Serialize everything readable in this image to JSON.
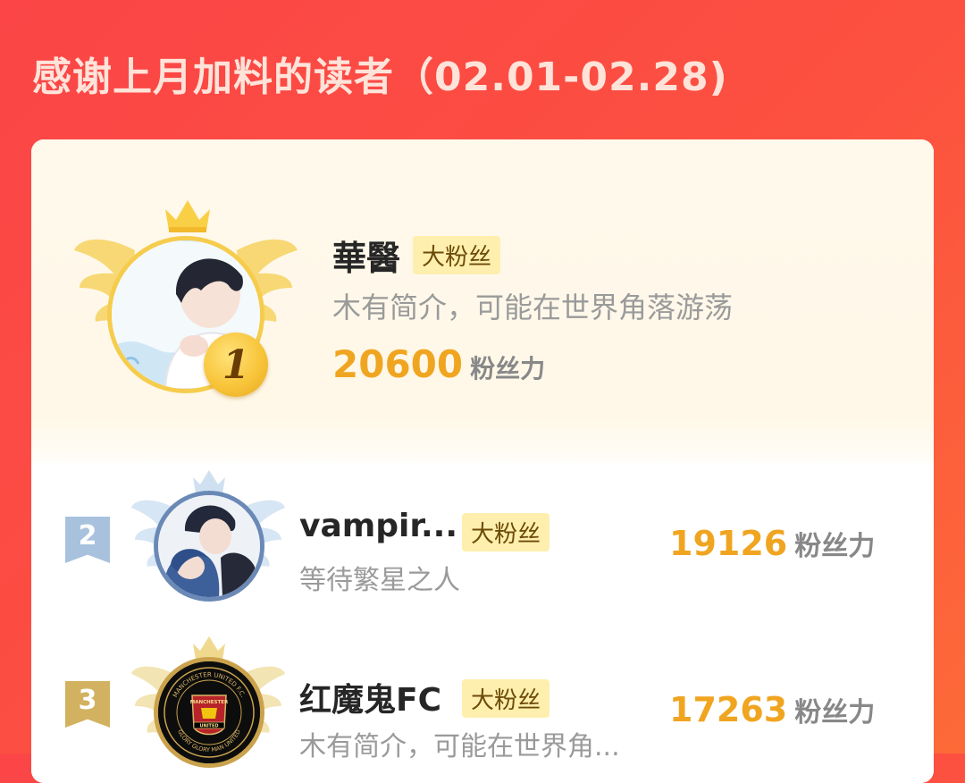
{
  "header": {
    "title": "感谢上月加料的读者（02.01-02.28)"
  },
  "colors": {
    "gold": "#f0a521",
    "badge_bg": "#ffefae",
    "red_bg": "#fb4547"
  },
  "top_fan": {
    "rank": "1",
    "name": "華醫",
    "badge": "大粉丝",
    "bio": "木有简介，可能在世界角落游荡",
    "score": "20600",
    "score_unit": "粉丝力",
    "frame_icon": "gold-crown-wings-frame"
  },
  "fans": [
    {
      "rank": "2",
      "name": "vampir...",
      "badge": "大粉丝",
      "bio": "等待繁星之人",
      "score": "19126",
      "score_unit": "粉丝力",
      "frame_icon": "silver-crown-wings-frame"
    },
    {
      "rank": "3",
      "name": "红魔鬼FC",
      "badge": "大粉丝",
      "bio": "木有简介，可能在世界角...",
      "score": "17263",
      "score_unit": "粉丝力",
      "frame_icon": "bronze-crown-wings-frame",
      "avatar_text": {
        "ring_top": "MANCHESTER UNITED F.C.",
        "center": "MANCHESTER",
        "band": "UNITED",
        "ring_bottom": "GLORY GLORY MAN UNITED"
      }
    }
  ]
}
